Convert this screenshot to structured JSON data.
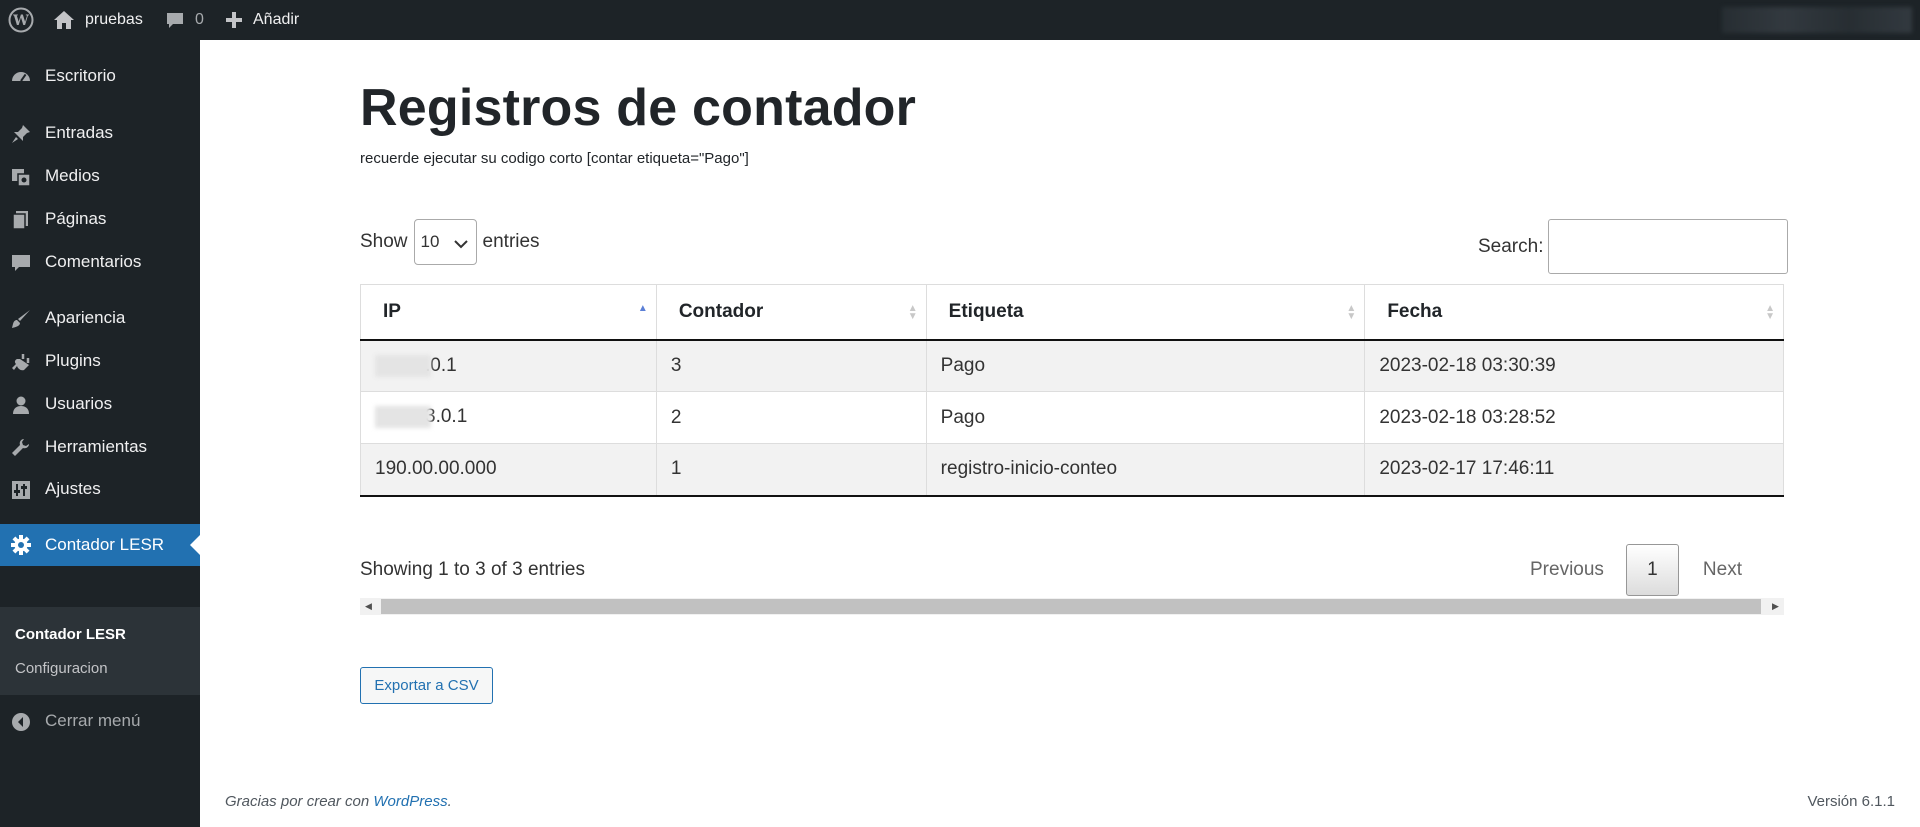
{
  "adminbar": {
    "site_name": "pruebas",
    "comments_count": "0",
    "new_label": "Añadir"
  },
  "sidebar": {
    "items": [
      {
        "label": "Escritorio",
        "icon": "dashboard-icon"
      },
      {
        "label": "Entradas",
        "icon": "pin-icon"
      },
      {
        "label": "Medios",
        "icon": "media-icon"
      },
      {
        "label": "Páginas",
        "icon": "pages-icon"
      },
      {
        "label": "Comentarios",
        "icon": "comment-icon"
      },
      {
        "label": "Apariencia",
        "icon": "brush-icon"
      },
      {
        "label": "Plugins",
        "icon": "plug-icon"
      },
      {
        "label": "Usuarios",
        "icon": "user-icon"
      },
      {
        "label": "Herramientas",
        "icon": "wrench-icon"
      },
      {
        "label": "Ajustes",
        "icon": "settings-sliders-icon"
      },
      {
        "label": "Contador LESR",
        "icon": "gear-icon"
      }
    ],
    "submenu": [
      "Contador LESR",
      "Configuracion"
    ],
    "collapse_label": "Cerrar menú"
  },
  "main": {
    "title": "Registros de contador",
    "note": "recuerde ejecutar su codigo corto [contar etiqueta=\"Pago\"]",
    "length": {
      "show": "Show",
      "value": "10",
      "entries": "entries"
    },
    "search_label": "Search:",
    "search_value": "",
    "table": {
      "headers": [
        "IP",
        "Contador",
        "Etiqueta",
        "Fecha"
      ],
      "rows": [
        {
          "ip": ".0.1",
          "contador": "3",
          "etiqueta": "Pago",
          "fecha": "2023-02-18 03:30:39"
        },
        {
          "ip": "3.0.1",
          "contador": "2",
          "etiqueta": "Pago",
          "fecha": "2023-02-18 03:28:52"
        },
        {
          "ip": "190.00.00.000",
          "contador": "1",
          "etiqueta": "registro-inicio-conteo",
          "fecha": "2023-02-17 17:46:11"
        }
      ]
    },
    "info": "Showing 1 to 3 of 3 entries",
    "pagination": {
      "previous": "Previous",
      "page": "1",
      "next": "Next"
    },
    "export_label": "Exportar a CSV"
  },
  "footer": {
    "thanks_prefix": "Gracias por crear con ",
    "thanks_link": "WordPress",
    "thanks_suffix": ".",
    "version": "Versión 6.1.1"
  },
  "colors": {
    "adminbar_bg": "#1d2327",
    "accent": "#2271b1",
    "sort_active": "#5b7fd6"
  }
}
